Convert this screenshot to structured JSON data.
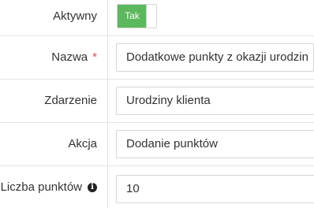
{
  "form": {
    "active": {
      "label": "Aktywny",
      "toggle_text": "Tak",
      "toggle_on": true,
      "toggle_color": "#5cb85c"
    },
    "name": {
      "label": "Nazwa",
      "required_marker": "*",
      "value": "Dodatkowe punkty z okazji urodzin"
    },
    "event": {
      "label": "Zdarzenie",
      "value": "Urodziny klienta"
    },
    "action": {
      "label": "Akcja",
      "value": "Dodanie punktów"
    },
    "points": {
      "label": "Liczba punktów",
      "info_icon": "info-circle-icon",
      "info_glyph": "i",
      "value": "10"
    }
  }
}
